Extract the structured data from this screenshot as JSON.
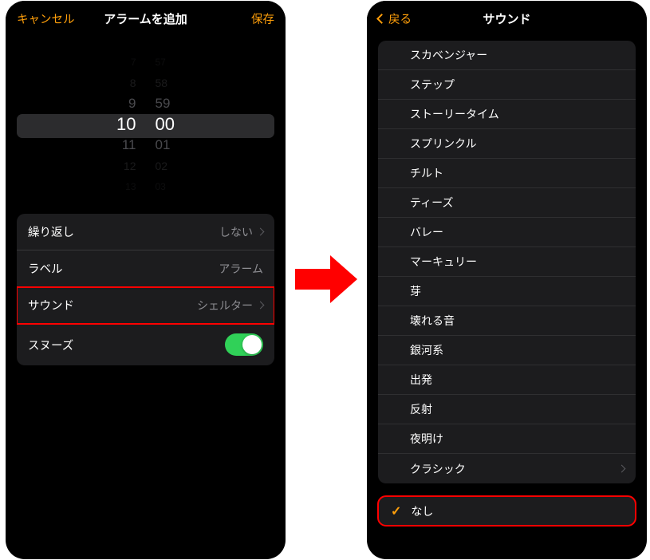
{
  "left": {
    "nav": {
      "cancel": "キャンセル",
      "title": "アラームを追加",
      "save": "保存"
    },
    "picker": {
      "hours": [
        "7",
        "8",
        "9",
        "10",
        "11",
        "12",
        "13"
      ],
      "minutes": [
        "57",
        "58",
        "59",
        "00",
        "01",
        "02",
        "03"
      ]
    },
    "rows": {
      "repeat": {
        "label": "繰り返し",
        "value": "しない"
      },
      "label": {
        "label": "ラベル",
        "value": "アラーム"
      },
      "sound": {
        "label": "サウンド",
        "value": "シェルター"
      },
      "snooze": {
        "label": "スヌーズ"
      }
    }
  },
  "right": {
    "nav": {
      "back": "戻る",
      "title": "サウンド"
    },
    "sounds": [
      "スカベンジャー",
      "ステップ",
      "ストーリータイム",
      "スプリンクル",
      "チルト",
      "ティーズ",
      "バレー",
      "マーキュリー",
      "芽",
      "壊れる音",
      "銀河系",
      "出発",
      "反射",
      "夜明け",
      "クラシック"
    ],
    "none": "なし"
  }
}
